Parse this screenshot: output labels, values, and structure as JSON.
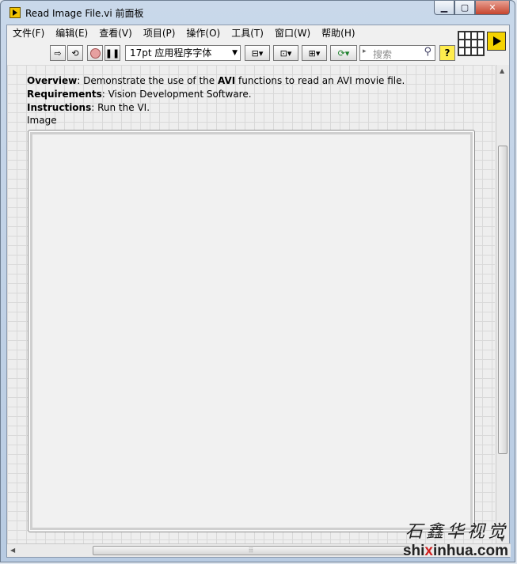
{
  "window": {
    "title": "Read Image File.vi 前面板",
    "min_label": "▁",
    "max_label": "▢",
    "close_label": "✕"
  },
  "menubar": {
    "items": [
      "文件(F)",
      "编辑(E)",
      "查看(V)",
      "项目(P)",
      "操作(O)",
      "工具(T)",
      "窗口(W)",
      "帮助(H)"
    ]
  },
  "toolbar": {
    "font_select": "17pt 应用程序字体",
    "search_placeholder": "搜索",
    "help_label": "?"
  },
  "panel": {
    "overview_label": "Overview",
    "overview_pre": ": Demonstrate the use of the ",
    "overview_bold": "AVI",
    "overview_post": " functions to read an AVI movie file.",
    "requirements_label": "Requirements",
    "requirements_text": ": Vision Development Software.",
    "instructions_label": "Instructions",
    "instructions_text": ": Run the VI.",
    "image_label": "Image"
  },
  "watermark": {
    "calligraphy": "石鑫华视觉",
    "site_pre": "shi",
    "site_x": "x",
    "site_post": "inhua.com"
  }
}
